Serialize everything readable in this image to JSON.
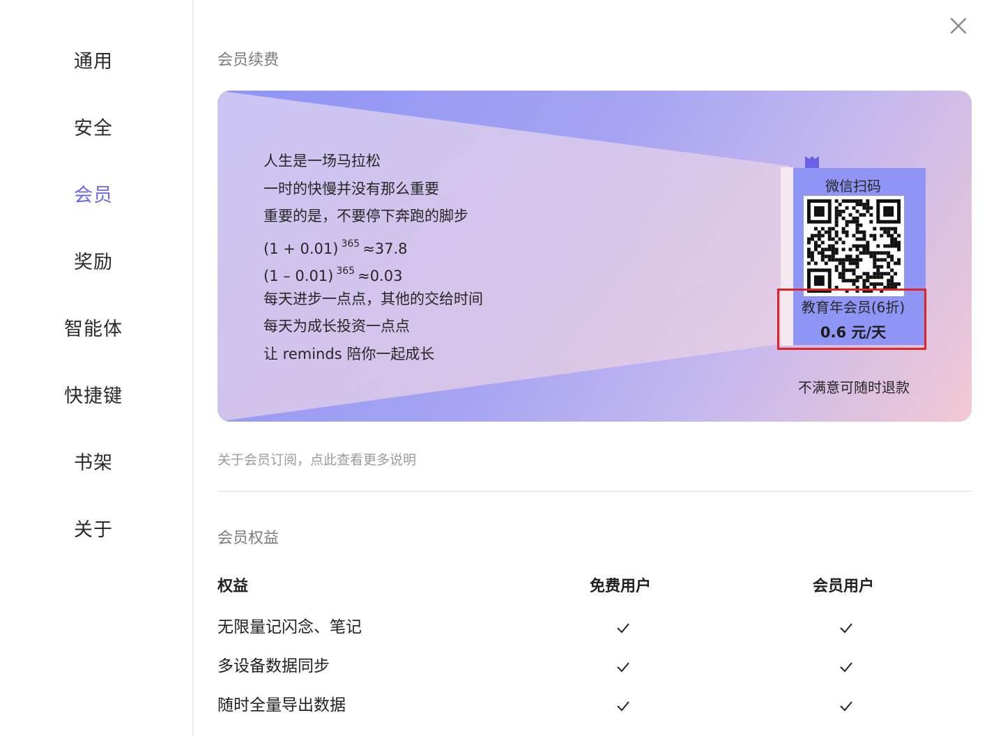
{
  "sidebar": {
    "items": [
      {
        "label": "通用",
        "active": false
      },
      {
        "label": "安全",
        "active": false
      },
      {
        "label": "会员",
        "active": true
      },
      {
        "label": "奖励",
        "active": false
      },
      {
        "label": "智能体",
        "active": false
      },
      {
        "label": "快捷键",
        "active": false
      },
      {
        "label": "书架",
        "active": false
      },
      {
        "label": "关于",
        "active": false
      }
    ],
    "active_color": "#6a68ea"
  },
  "renewal": {
    "title": "会员续费",
    "poem": {
      "line1": "人生是一场马拉松",
      "line2": "一时的快慢并没有那么重要",
      "line3": "重要的是，不要停下奔跑的脚步",
      "line4_base": "(1 + 0.01)",
      "line4_exp": "365",
      "line4_result": "≈37.8",
      "line5_base": "(1 – 0.01)",
      "line5_exp": "365",
      "line5_result": "≈0.03",
      "line6": "每天进步一点点，其他的交给时间",
      "line7": "每天为成长投资一点点",
      "line8": "让 reminds 陪你一起成长"
    },
    "qr": {
      "caption": "微信扫码",
      "icon": "qr-code-icon",
      "plan_name": "教育年会员(6折)",
      "plan_price": "0.6 元/天"
    },
    "refund_note": "不满意可随时退款",
    "subscription_link": "关于会员订阅，点此查看更多说明"
  },
  "benefits": {
    "title": "会员权益",
    "headers": {
      "benefit": "权益",
      "free": "免费用户",
      "member": "会员用户"
    },
    "rows": [
      {
        "benefit": "无限量记闪念、笔记",
        "free": true,
        "member": true
      },
      {
        "benefit": "多设备数据同步",
        "free": true,
        "member": true
      },
      {
        "benefit": "随时全量导出数据",
        "free": true,
        "member": true
      }
    ]
  },
  "icons": {
    "close": "close-icon",
    "check": "check-icon",
    "flag": "bookmark-flag-icon"
  },
  "colors": {
    "highlight": "#e02424",
    "banner_start": "#8d94f5",
    "banner_end": "#f2c9d4"
  }
}
